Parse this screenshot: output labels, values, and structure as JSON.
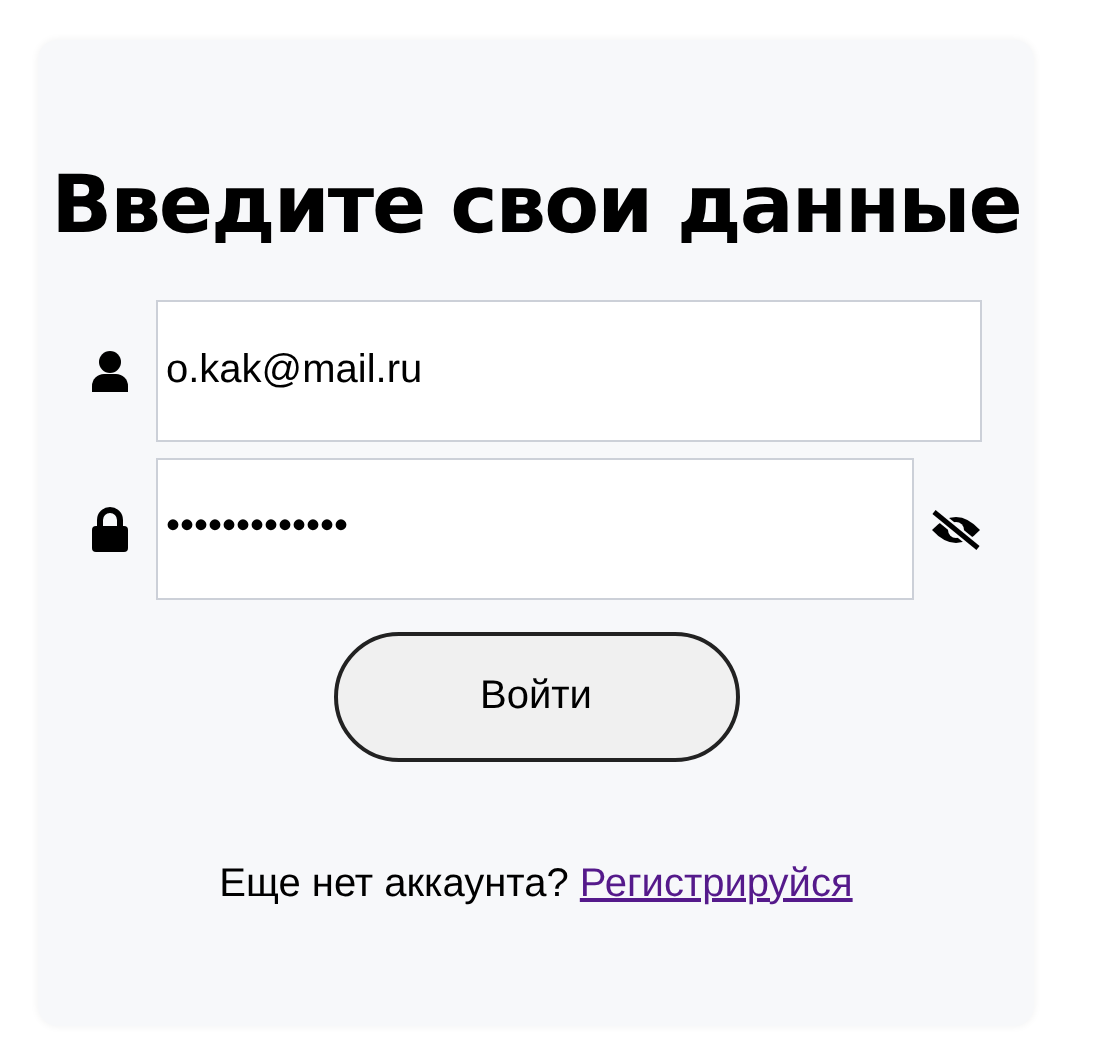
{
  "title": "Введите свои данные",
  "email_field": {
    "value": "o.kak@mail.ru"
  },
  "password_field": {
    "value": "•••••••••••••",
    "visible": false
  },
  "login_button": {
    "label": "Войти"
  },
  "footer": {
    "text": "Еще нет аккаунта?",
    "link": "Регистрируйся"
  }
}
